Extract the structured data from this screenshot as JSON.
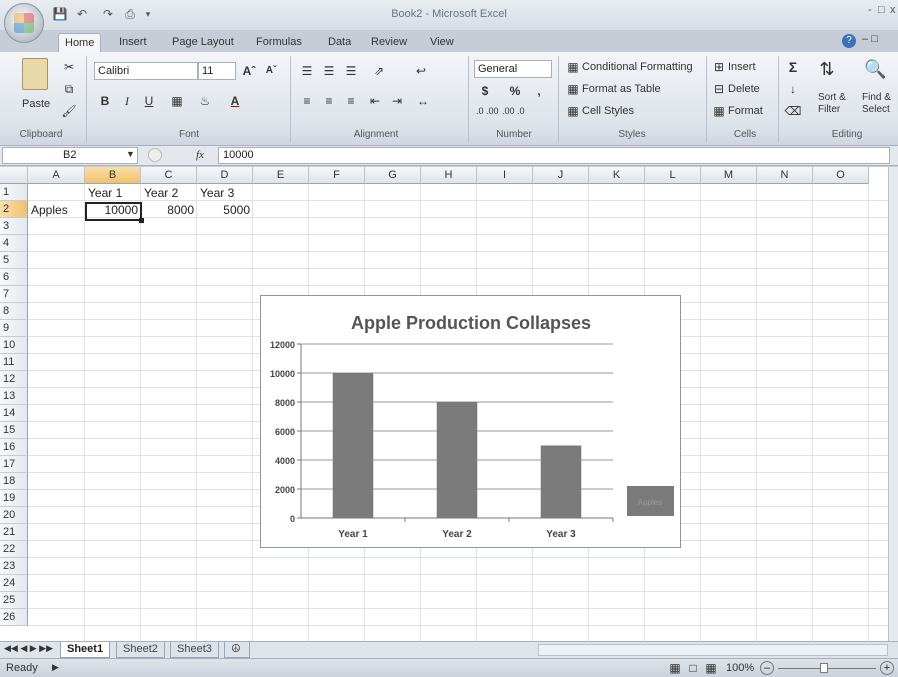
{
  "window": {
    "title": "Book2 - Microsoft Excel",
    "controls": [
      "-",
      "□",
      "x"
    ]
  },
  "qat": [
    "save-icon",
    "undo-icon",
    "redo-icon",
    "customize-icon"
  ],
  "tabs": [
    "Home",
    "Insert",
    "Page Layout",
    "Formulas",
    "Data",
    "Review",
    "View"
  ],
  "ribbon": {
    "clipboard": {
      "paste": "Paste",
      "label": "Clipboard"
    },
    "font": {
      "name": "Calibri",
      "size": "11",
      "bold": "B",
      "italic": "I",
      "underline": "U",
      "grow": "Aˆ",
      "shrink": "Aˇ",
      "label": "Font"
    },
    "alignment": {
      "label": "Alignment"
    },
    "number": {
      "format": "General",
      "currency": "$",
      "percent": "%",
      "comma": ",",
      "inc_dec": ".0 .00",
      "dec_dec": ".00 .0",
      "label": "Number"
    },
    "styles": {
      "conditional": "Conditional Formatting",
      "format_table": "Format as Table",
      "cell_styles": "Cell Styles",
      "label": "Styles"
    },
    "cells": {
      "insert": "Insert",
      "delete": "Delete",
      "format": "Format",
      "label": "Cells"
    },
    "editing": {
      "sigma": "Σ",
      "sort": "Sort &",
      "sort2": "Filter",
      "find": "Find &",
      "find2": "Select",
      "label": "Editing"
    }
  },
  "formula_bar": {
    "name_box": "B2",
    "fx": "fx",
    "value": "10000"
  },
  "columns": [
    "A",
    "B",
    "C",
    "D",
    "E",
    "F",
    "G",
    "H",
    "I",
    "J",
    "K",
    "L",
    "M",
    "N",
    "O"
  ],
  "rows": [
    "1",
    "2",
    "3",
    "4",
    "5",
    "6",
    "7",
    "8",
    "9",
    "10",
    "11",
    "12",
    "13",
    "14",
    "15",
    "16",
    "17",
    "18",
    "19",
    "20",
    "21",
    "22",
    "23",
    "24",
    "25",
    "26"
  ],
  "cells": {
    "B1": "Year 1",
    "C1": "Year 2",
    "D1": "Year 3",
    "A2": "Apples",
    "B2": "10000",
    "C2": "8000",
    "D2": "5000"
  },
  "chart_data": {
    "type": "bar",
    "title": "Apple Production Collapses",
    "categories": [
      "Year 1",
      "Year 2",
      "Year 3"
    ],
    "series": [
      {
        "name": "Apples",
        "values": [
          10000,
          8000,
          5000
        ]
      }
    ],
    "yticks": [
      "0",
      "2000",
      "4000",
      "6000",
      "8000",
      "10000",
      "12000"
    ],
    "ylim": [
      0,
      12000
    ],
    "grid": true,
    "legend": "right",
    "bar_color": "#7a7a7a"
  },
  "sheets": [
    "Sheet1",
    "Sheet2",
    "Sheet3"
  ],
  "status": {
    "ready": "Ready",
    "zoom": "100%"
  }
}
